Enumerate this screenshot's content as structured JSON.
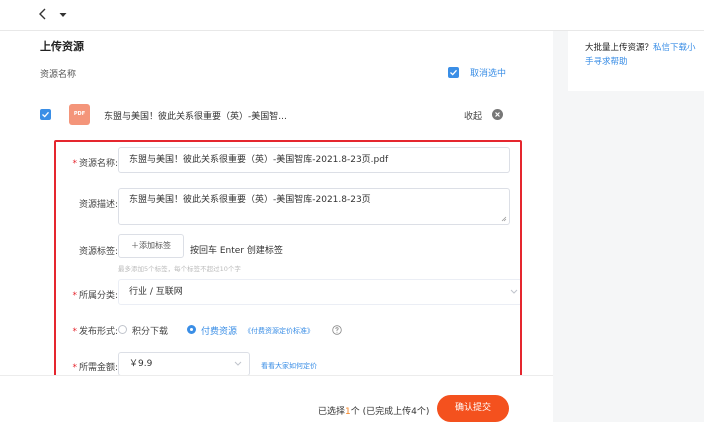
{
  "side_panel": {
    "line1_text": "大批量上传资源？",
    "line1_link": "私信下载小",
    "line2_link": "手寻求帮助"
  },
  "upload": {
    "title": "上传资源",
    "column_label": "资源名称",
    "cancel_select": "取消选中",
    "file_icon_label": "PDF",
    "file_name": "东盟与美国！彼此关系很重要（英）-美国智...",
    "collapse_label": "收起"
  },
  "form": {
    "required_mark": "*",
    "name_label": "资源名称:",
    "name_value": "东盟与美国！彼此关系很重要（英）-美国智库-2021.8-23页.pdf",
    "desc_label": "资源描述:",
    "desc_value": "东盟与美国！彼此关系很重要（英）-美国智库-2021.8-23页",
    "tags_label": "资源标签:",
    "add_tag_button": "＋添加标签",
    "tags_instruction": "按回车 Enter 创建标签",
    "tags_hint": "最多添加5个标签，每个标签不超过10个字",
    "category_label": "所属分类:",
    "category_value": "行业 / 互联网",
    "publish_label": "发布形式:",
    "publish_options": [
      "积分下载",
      "付费资源"
    ],
    "pricing_link": "《付费资源定价标准》",
    "price_label": "所需金额:",
    "price_value": "￥9.9",
    "price_help_link": "看看大家如何定价"
  },
  "footer": {
    "selected_prefix": "已选择",
    "selected_count": "1",
    "selected_suffix": "个 (已完成上传4个)",
    "submit_button": "确认提交"
  },
  "colors": {
    "accent": "#3a8ee6",
    "highlight_border": "#e5262e",
    "submit": "#f4511e",
    "pdf_icon": "#f4957a"
  }
}
